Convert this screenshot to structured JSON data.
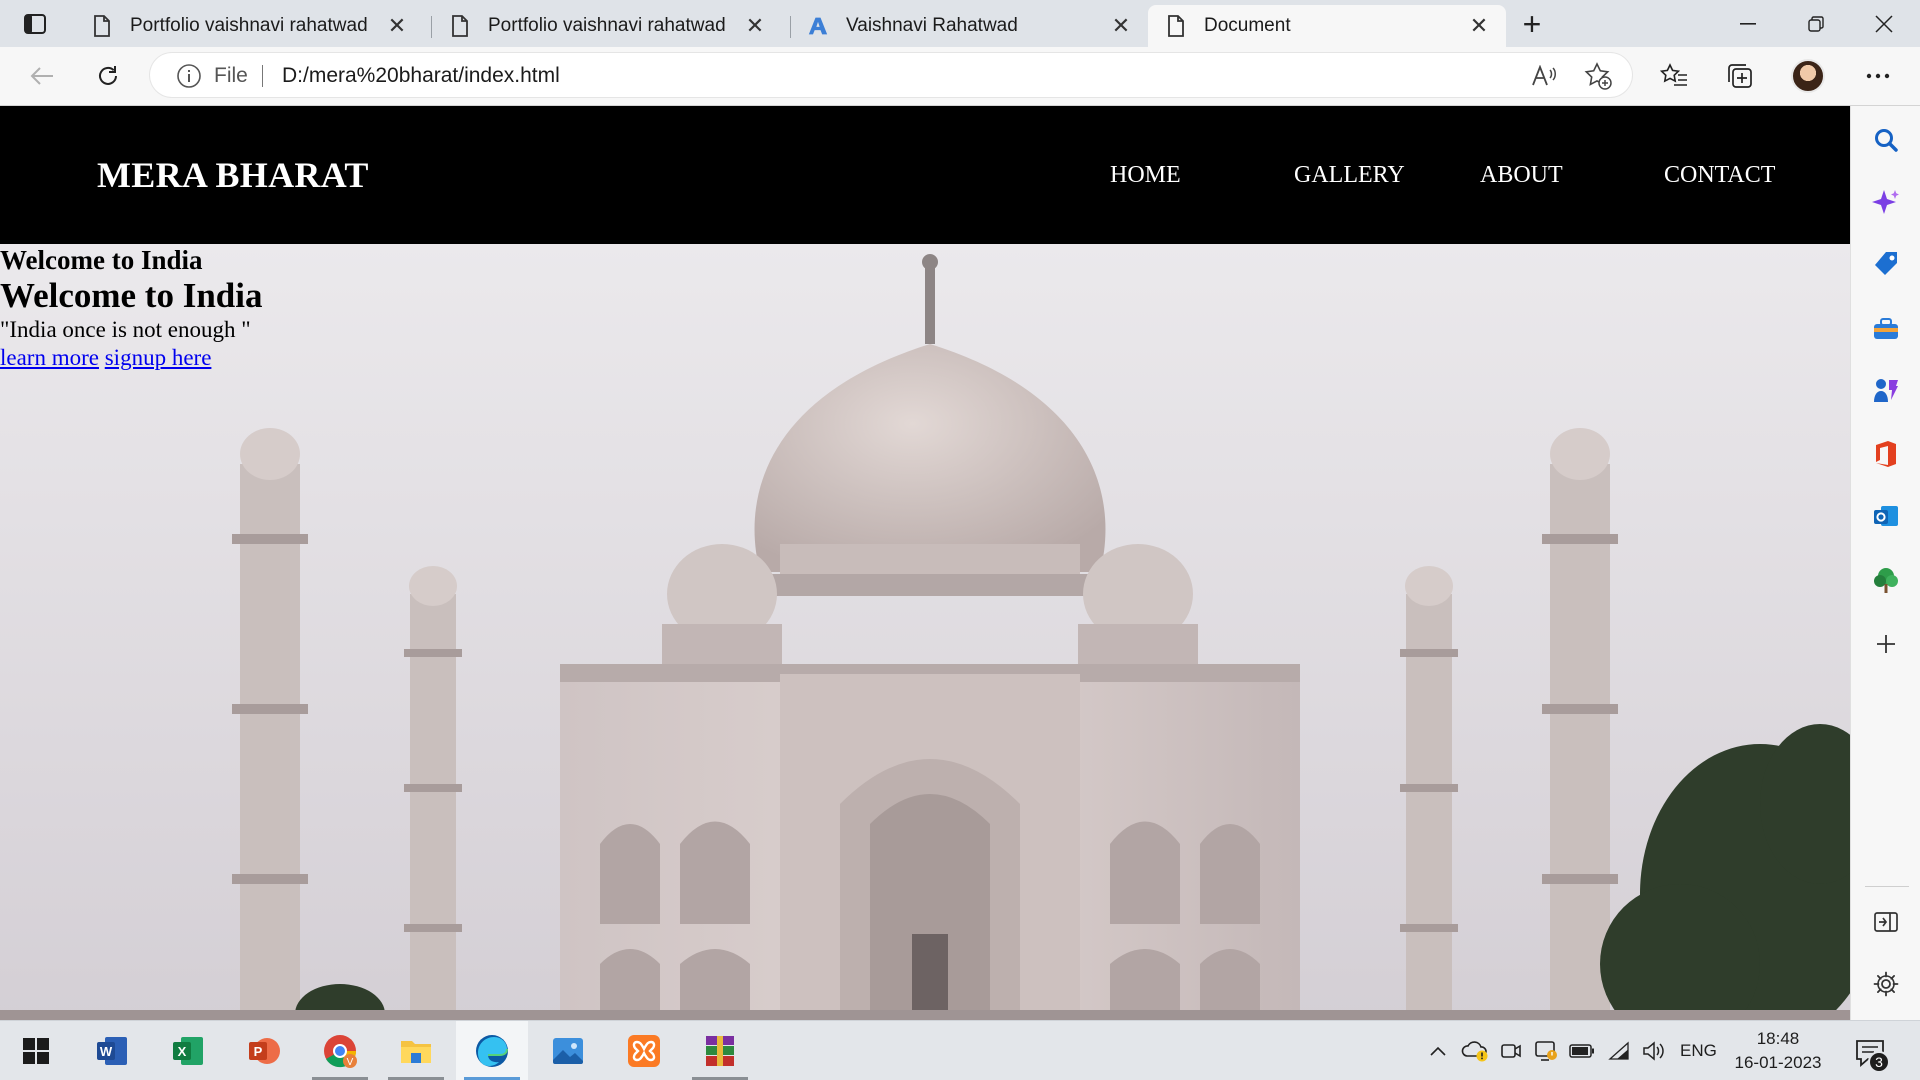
{
  "browser": {
    "tabs": [
      {
        "title": "Portfolio vaishnavi rahatwad",
        "icon": "page-icon",
        "active": false
      },
      {
        "title": "Portfolio vaishnavi rahatwad",
        "icon": "page-icon",
        "active": false
      },
      {
        "title": "Vaishnavi Rahatwad",
        "icon": "azure-a-icon",
        "active": false
      },
      {
        "title": "Document",
        "icon": "page-icon",
        "active": true
      }
    ],
    "address": {
      "scheme_label": "File",
      "url": "D:/mera%20bharat/index.html"
    }
  },
  "site": {
    "brand": "MERA BHARAT",
    "nav": [
      "HOME",
      "GALLERY",
      "ABOUT",
      "CONTACT"
    ],
    "heading_small": "Welcome to India",
    "heading_big": "Welcome to India",
    "quote": "\"India once is not enough \"",
    "link_learn": "learn more",
    "link_signup": "signup here"
  },
  "sidebar": {
    "icons": [
      "search-icon",
      "copilot-icon",
      "shopping-tag-icon",
      "tools-icon",
      "games-icon",
      "office-icon",
      "outlook-icon",
      "tree-icon",
      "add-icon",
      "hide-sidebar-icon",
      "settings-icon"
    ]
  },
  "taskbar": {
    "apps": [
      "windows-start",
      "word",
      "excel",
      "powerpoint",
      "chrome",
      "file-explorer",
      "edge",
      "photos",
      "xampp",
      "winrar"
    ],
    "language": "ENG",
    "time": "18:48",
    "date": "16-01-2023",
    "notification_count": "3"
  },
  "colors": {
    "nav_bg": "#000000",
    "link": "#0000ee",
    "edge_blue": "#0c59a4",
    "accent": "#5a9bd8"
  }
}
